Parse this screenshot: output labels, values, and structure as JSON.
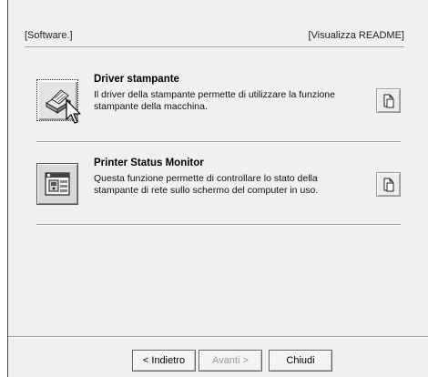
{
  "header": {
    "left_label": "[Software.]",
    "right_label": "[Visualizza README]"
  },
  "items": [
    {
      "title": "Driver stampante",
      "description_line1": "Il driver della stampante permette di utilizzare la funzione",
      "description_line2": "stampante della macchina.",
      "icon": "printer-icon"
    },
    {
      "title": "Printer Status Monitor",
      "description_line1": "Questa funzione permette di controllare lo stato della",
      "description_line2": "stampante di rete sullo schermo del computer in uso.",
      "icon": "status-monitor-icon"
    }
  ],
  "footer": {
    "back_label": "< Indietro",
    "next_label": "Avanti >",
    "close_label": "Chiudi"
  }
}
